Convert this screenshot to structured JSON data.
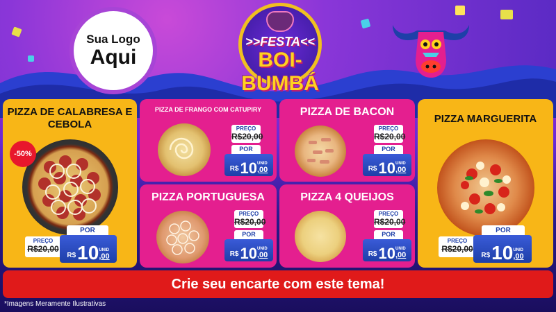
{
  "logo": {
    "line1": "Sua Logo",
    "line2": "Aqui"
  },
  "festa": {
    "line1": ">>FESTA<<",
    "line2": "BOI-BUMBÁ"
  },
  "products": [
    {
      "name": "PIZZA DE CALABRESA E CEBOLA",
      "discount": "-50%",
      "preco_label": "PREÇO",
      "old_price": "R$20,00",
      "por_label": "POR",
      "currency": "R$",
      "price_int": "10",
      "price_dec": ",00",
      "unit": "UNID"
    },
    {
      "name": "PIZZA DE FRANGO COM CATUPIRY",
      "preco_label": "PREÇO",
      "old_price": "R$20,00",
      "por_label": "POR",
      "currency": "R$",
      "price_int": "10",
      "price_dec": ",00",
      "unit": "UNID"
    },
    {
      "name": "PIZZA DE BACON",
      "preco_label": "PREÇO",
      "old_price": "R$20,00",
      "por_label": "POR",
      "currency": "R$",
      "price_int": "10",
      "price_dec": ",00",
      "unit": "UNID"
    },
    {
      "name": "PIZZA MARGUERITA",
      "preco_label": "PREÇO",
      "old_price": "R$20,00",
      "por_label": "POR",
      "currency": "R$",
      "price_int": "10",
      "price_dec": ",00",
      "unit": "UNID"
    },
    {
      "name": "PIZZA PORTUGUESA",
      "preco_label": "PREÇO",
      "old_price": "R$20,00",
      "por_label": "POR",
      "currency": "R$",
      "price_int": "10",
      "price_dec": ",00",
      "unit": "UNID"
    },
    {
      "name": "PIZZA 4 QUEIJOS",
      "preco_label": "PREÇO",
      "old_price": "R$20,00",
      "por_label": "POR",
      "currency": "R$",
      "price_int": "10",
      "price_dec": ",00",
      "unit": "UNID"
    }
  ],
  "banner": {
    "text": "Crie seu encarte com este tema!"
  },
  "footnote": "*Imagens Meramente Ilustrativas",
  "colors": {
    "pink": "#e41f8f",
    "yellow": "#f8b617",
    "blue": "#1e3fa8",
    "red": "#e01a1a"
  }
}
